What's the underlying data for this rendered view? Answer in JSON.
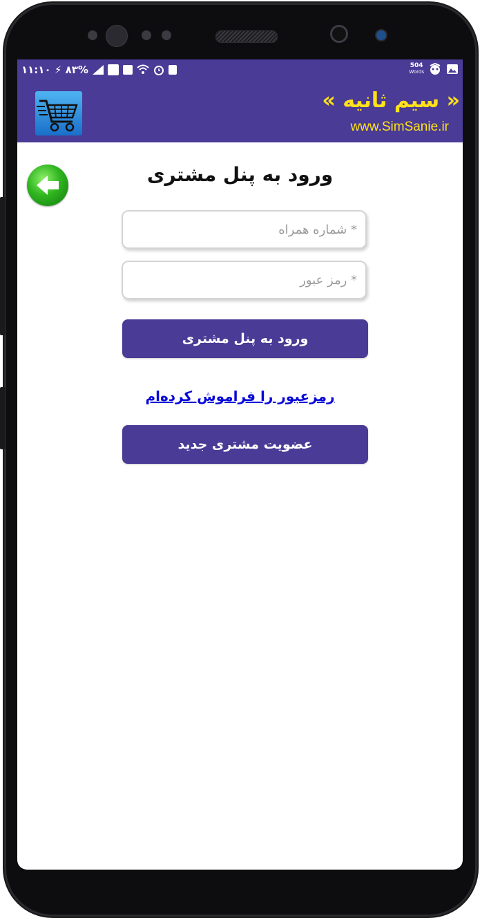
{
  "status_bar": {
    "time_battery": "۱۱:۱۰ ⚡ ۸۳%",
    "words_count": "504",
    "words_label": "Words"
  },
  "header": {
    "brand_title": "« سیم ثانیه »",
    "brand_url": "www.SimSanie.ir"
  },
  "page": {
    "title": "ورود به پنل مشتری"
  },
  "form": {
    "phone_placeholder": "* شماره همراه",
    "password_placeholder": "* رمز عبور",
    "login_button": "ورود به پنل مشتری",
    "forgot_link": "رمزعبور را فراموش کرده‌ام",
    "register_button": "عضویت مشتری جدید"
  },
  "colors": {
    "primary": "#493b96",
    "brand_yellow": "#ffe21a",
    "link_blue": "#0a0ad8",
    "back_green": "#2fb51f"
  },
  "icons": {
    "back": "back-arrow-icon",
    "logo": "shopping-cart-icon"
  }
}
